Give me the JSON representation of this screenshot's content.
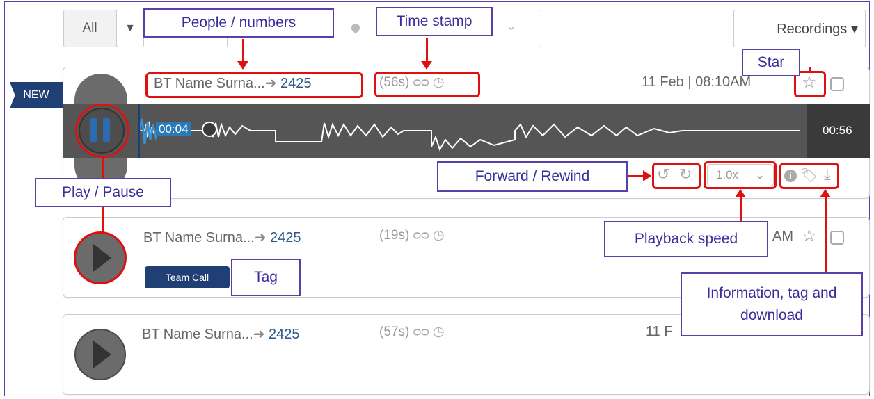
{
  "toolbar": {
    "filter_all_label": "All",
    "dropdown_caret": "▾",
    "recordings_label": "Recordings ▾"
  },
  "calls": [
    {
      "badge": "NEW",
      "caller": "BT Name Surna...",
      "arrow": "➜",
      "extension": "2425",
      "duration": "(56s)",
      "date": "11 Feb | 08:10AM",
      "time_elapsed": "00:04",
      "time_total": "00:56",
      "speed": "1.0x",
      "state": "playing"
    },
    {
      "caller": "BT Name Surna...",
      "arrow": "➜",
      "extension": "2425",
      "duration": "(19s)",
      "date_partial": "AM",
      "tag": "Team Call",
      "state": "paused"
    },
    {
      "caller": "BT Name Surna...",
      "arrow": "➜",
      "extension": "2425",
      "duration": "(57s)",
      "date_partial": "11 F",
      "state": "paused"
    }
  ],
  "annotations": {
    "people_numbers": "People / numbers",
    "time_stamp": "Time stamp",
    "star": "Star",
    "forward_rewind": "Forward / Rewind",
    "play_pause": "Play / Pause",
    "playback_speed": "Playback speed",
    "tag": "Tag",
    "info_tag_download": "Information, tag and download"
  },
  "colors": {
    "annotation_border": "#5a3fa8",
    "annotation_text": "#3a2f9a",
    "highlight": "#e01010",
    "badge": "#1f3f75",
    "waveform_bg": "#5a5a5a",
    "progress": "#2a7ab8"
  },
  "icons": [
    "voicemail-icon",
    "clock-icon",
    "star-icon",
    "checkbox-icon",
    "rewind-icon",
    "forward-icon",
    "info-icon",
    "tag-icon",
    "download-icon",
    "location-icon",
    "chevron-down-icon",
    "play-icon",
    "pause-icon"
  ]
}
